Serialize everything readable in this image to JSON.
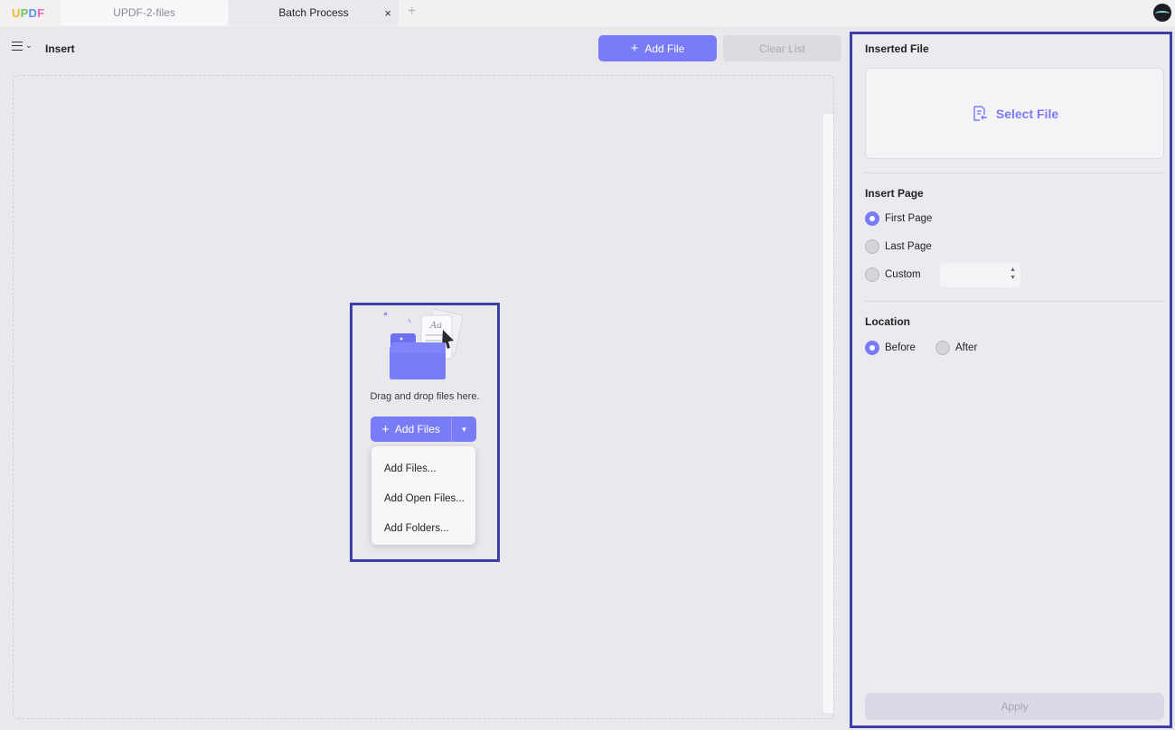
{
  "app": {
    "logo": "UPDF"
  },
  "tabs": [
    {
      "label": "UPDF-2-files",
      "active": false
    },
    {
      "label": "Batch Process",
      "active": true
    }
  ],
  "icons": {
    "close": "×",
    "add_tab": "+",
    "plus": "+",
    "dropdown_arrow": "▼",
    "stepper": "▲▼"
  },
  "toolbar": {
    "title": "Insert",
    "add_file_label": "Add File",
    "clear_list_label": "Clear List"
  },
  "drop_zone": {
    "text": "Drag and drop files here.",
    "add_files_label": "Add Files",
    "menu": [
      "Add Files...",
      "Add Open Files...",
      "Add Folders..."
    ]
  },
  "right_panel": {
    "inserted_file_label": "Inserted File",
    "select_file_label": "Select File",
    "insert_page_label": "Insert Page",
    "insert_page_options": [
      {
        "label": "First Page",
        "selected": true
      },
      {
        "label": "Last Page",
        "selected": false
      },
      {
        "label": "Custom",
        "selected": false
      }
    ],
    "custom_value": "",
    "location_label": "Location",
    "location_options": [
      {
        "label": "Before",
        "selected": true
      },
      {
        "label": "After",
        "selected": false
      }
    ],
    "apply_label": "Apply"
  },
  "colors": {
    "accent": "#7a7cf7",
    "highlight_border": "#3d3fa8"
  }
}
